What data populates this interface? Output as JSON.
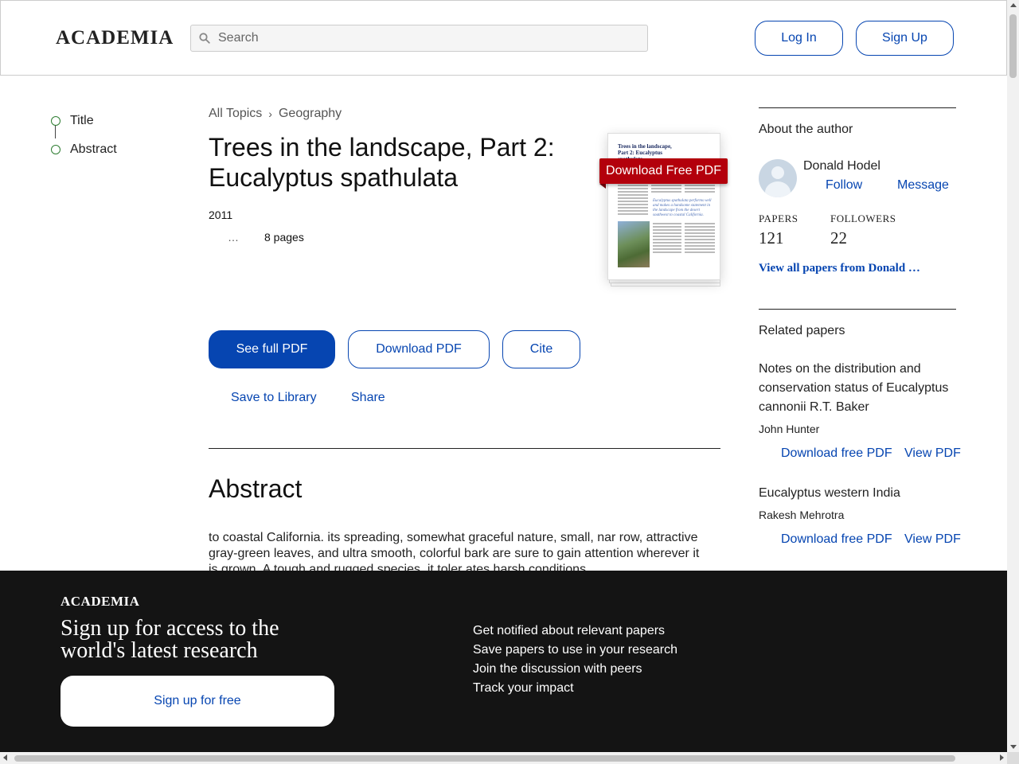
{
  "header": {
    "logo": "ACADEMIA",
    "search_placeholder": "Search",
    "login_label": "Log In",
    "signup_label": "Sign Up"
  },
  "toc": {
    "items": [
      {
        "label": "Title"
      },
      {
        "label": "Abstract"
      }
    ]
  },
  "breadcrumb": {
    "items": [
      "All Topics",
      "Geography"
    ],
    "separator": "›"
  },
  "paper": {
    "title": "Trees in the landscape, Part 2: Eucalyptus spathulata",
    "year": "2011",
    "ellipsis": "…",
    "pages": "8 pages",
    "download_free_label": "Download Free PDF",
    "thumbnail_title": "Trees in the landscape, Part 2: Eucalyptus spathulata",
    "thumbnail_quote": "Eucalyptus spathulata performs well and makes a handsome statement in the landscape from the desert southwest to coastal California."
  },
  "actions": {
    "see_full_pdf": "See full PDF",
    "download_pdf": "Download PDF",
    "cite": "Cite",
    "save_to_library": "Save to Library",
    "share": "Share"
  },
  "abstract": {
    "heading": "Abstract",
    "text": "to coastal California. its spreading, somewhat graceful nature, small, nar row, attractive gray-green leaves, and ultra smooth, colorful bark are sure to gain attention wherever it is grown. A tough and rugged species, it toler ates harsh conditions"
  },
  "author": {
    "section_heading": "About the author",
    "name": "Donald Hodel",
    "follow_label": "Follow",
    "message_label": "Message",
    "papers_label": "PAPERS",
    "papers_count": "121",
    "followers_label": "FOLLOWERS",
    "followers_count": "22",
    "view_all_label": "View all papers from Donald …"
  },
  "related": {
    "heading": "Related papers",
    "papers": [
      {
        "title": "Notes on the distribution and conservation status of Eucalyptus cannonii R.T. Baker",
        "author": "John Hunter",
        "download_label": "Download free PDF",
        "view_label": "View PDF"
      },
      {
        "title": "Eucalyptus western India",
        "author": "Rakesh Mehrotra",
        "download_label": "Download free PDF",
        "view_label": "View PDF"
      }
    ]
  },
  "banner": {
    "logo": "ACADEMIA",
    "title": "Sign up for access to the world's latest research",
    "button_label": "Sign up for free",
    "benefits": [
      "Get notified about relevant papers",
      "Save papers to use in your research",
      "Join the discussion with peers",
      "Track your impact"
    ]
  },
  "colors": {
    "brand_blue": "#0645b1",
    "download_red": "#b3000c",
    "banner_bg": "#141414"
  }
}
